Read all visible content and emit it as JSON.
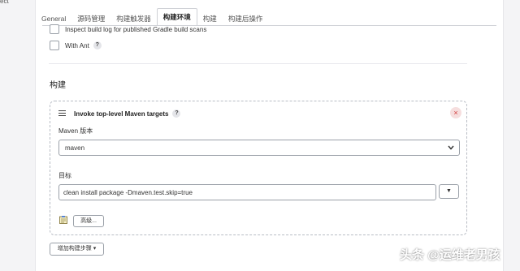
{
  "corner_text": "ect",
  "tabs": [
    {
      "label": "General"
    },
    {
      "label": "源码管理"
    },
    {
      "label": "构建触发器"
    },
    {
      "label": "构建环境"
    },
    {
      "label": "构建"
    },
    {
      "label": "构建后操作"
    }
  ],
  "active_tab": "构建环境",
  "options": {
    "inspect_label": "Inspect build log for published Gradle build scans",
    "with_ant_label": "With Ant",
    "help_glyph": "?"
  },
  "section": {
    "title": "构建"
  },
  "step": {
    "title": "Invoke top-level Maven targets",
    "help_glyph": "?",
    "close_glyph": "×",
    "maven_version_label": "Maven 版本",
    "maven_version_value": "maven",
    "goals_label": "目标",
    "goals_value": "clean install package -Dmaven.test.skip=true",
    "expand_glyph": "▼",
    "advanced_label": "高级..."
  },
  "add_step_label": "增加构建步骤 ▾",
  "watermark": "头条 @运维老男孩",
  "colors": {
    "close_bg": "#f6dede",
    "close_fg": "#d23b3b",
    "panel_bg": "#ffffff",
    "page_bg": "#f4f4f6"
  }
}
